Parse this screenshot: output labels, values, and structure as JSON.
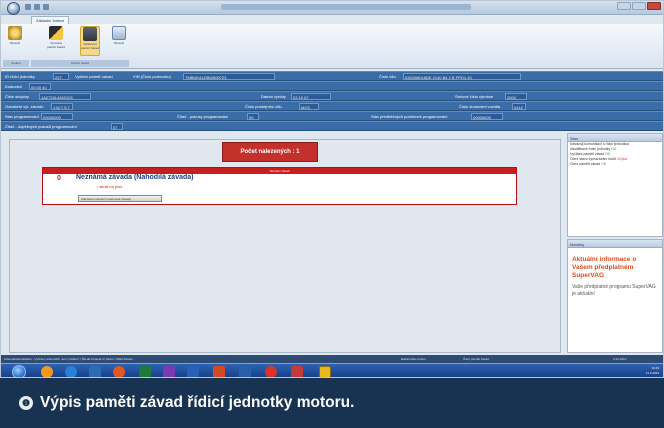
{
  "ribbon": {
    "tab_label": "Základní funkce",
    "buttons": [
      {
        "label": "Obnovit"
      },
      {
        "label": "Vymazat paměť závad"
      },
      {
        "label": "Vytisknout paměť závad"
      },
      {
        "label": "Obnovit"
      }
    ],
    "group_labels": [
      "Soubor",
      "Paměť závad"
    ]
  },
  "info": {
    "id_lbl": "ID řídicí jednotky",
    "id_val": "227",
    "read_lbl": "Vyčtení paměť závad",
    "vin_lbl": "VIN (Číslo podvozku)",
    "vin_val": "TMBDK41Z9B2800723",
    "part_lbl": "Číslo dílu",
    "part_val": "03G906018DE 2140 B4 2 B PPD1.10",
    "coding_lbl": "Kódování",
    "coding_val": "00 00 40",
    "version_lbl": "Číslo skupiny",
    "version_val": "1A2720L4462103",
    "date_lbl": "Datum výroby",
    "date_val": "03 10 07",
    "serial_lbl": "Sériové číslo výrobce",
    "serial_val": "2004",
    "importer_lbl": "Označení výr. závodu",
    "importer_val": "J.W.T.S.T",
    "workshop_lbl": "Číslo prodejního dílu",
    "workshop_val": "MO3",
    "equipment_lbl": "Číslo zhotovení vozidla",
    "equipment_val": "0412",
    "prog_lbl": "Stav programování",
    "prog_val": "00000000",
    "attempts_lbl": "Čítač - pokusy programování",
    "attempts_val": "00",
    "preconditions_lbl": "Stav předběžných podmínek programování",
    "preconditions_val": "00000000",
    "success_lbl": "Čítač - úspěšných pokusů programování",
    "success_val": "07"
  },
  "main": {
    "count_label": "Počet nalezených : 1",
    "fault_header": "Seznam závad",
    "fault_code": "0",
    "fault_name": "Neznámá závada (Nahodilá závada)",
    "fault_detail": "• skrat na plus",
    "freeze_button": "Zobrazení okolních podmínek závady"
  },
  "status_panel": {
    "title": "Stav",
    "lines": [
      "Navazuji komunikaci s řídicí jednotkou",
      "Identifikace řídicí jednotky",
      "Vyčítání paměti závad",
      "Čtení stavu vymazávání kódů",
      "Čtení paměti závad"
    ],
    "line_states": [
      "",
      "OK",
      "OK",
      "Chyba",
      "OK"
    ]
  },
  "news_panel": {
    "title": "Novinky",
    "heading": "Aktuální informace o Vašem předplatném SuperVAG",
    "body": "Vaše předplatné programu SuperVAG je aktuální"
  },
  "statusbar": {
    "left": "Automatická detekce - Vybraný automobil: není | Fabia II | Škoda Octavia II | Motor: CBZA Diesel",
    "mid1": "Elektronika motoru",
    "mid2": "Čtení paměti závad",
    "right": "3.22.2010"
  },
  "taskbar": {
    "time": "10:43",
    "date": "11.2.2013"
  },
  "caption": {
    "number": "❶",
    "text": "Výpis paměti závad řídicí jednotky motoru."
  }
}
